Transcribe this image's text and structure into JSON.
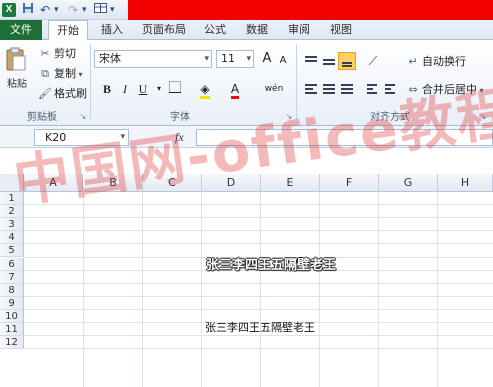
{
  "title_bar": {
    "app_icon": "X",
    "quick_access": {
      "save_icon": "save-icon",
      "undo_icon": "undo-icon",
      "redo_icon": "redo-icon",
      "customize_icon": "table-icon"
    },
    "accent_color": "#f20000"
  },
  "tabs": [
    "文件",
    "开始",
    "插入",
    "页面布局",
    "公式",
    "数据",
    "审阅",
    "视图"
  ],
  "active_tab": "开始",
  "ribbon": {
    "clipboard": {
      "paste": "粘贴",
      "cut": "剪切",
      "copy": "复制",
      "format_painter": "格式刷",
      "group_label": "剪贴板"
    },
    "font": {
      "font_name": "宋体",
      "font_size": "11",
      "bold": "B",
      "italic": "I",
      "underline": "U",
      "grow": "A",
      "shrink": "A",
      "font_color": "A",
      "phonetic": "wén",
      "group_label": "字体"
    },
    "alignment": {
      "wrap_text": "自动换行",
      "merge_center": "合并后居中",
      "group_label": "对齐方式"
    }
  },
  "formula_bar": {
    "name_box": "K20",
    "fx_label": "fx",
    "formula": ""
  },
  "sheet": {
    "columns": [
      "A",
      "B",
      "C",
      "D",
      "E",
      "F",
      "G",
      "H"
    ],
    "rows": [
      "1",
      "2",
      "3",
      "4",
      "5",
      "6",
      "7",
      "8",
      "9",
      "10",
      "11",
      "12"
    ],
    "cells": {
      "D5": "张三李四王五隔壁老王",
      "D9": "张三李四王五隔壁老王"
    }
  },
  "watermark": "中国网-office教程网"
}
